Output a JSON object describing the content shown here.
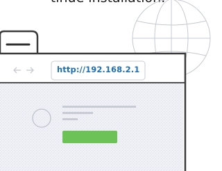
{
  "instruction": {
    "text": "tinue installation."
  },
  "browser": {
    "address_bar": {
      "url": "http://192.168.2.1"
    }
  },
  "colors": {
    "url_text": "#1f6fb3",
    "window_outline": "#3a3a3a",
    "toolbar_bg": "#ffffff",
    "content_bg": "#eef0f6",
    "placeholder_bar": "#c8cbd3",
    "action_button": "#6dc257"
  },
  "icons": [
    "globe-icon",
    "back-arrow-icon",
    "forward-arrow-icon",
    "avatar-placeholder-icon",
    "browser-tab-icon"
  ]
}
